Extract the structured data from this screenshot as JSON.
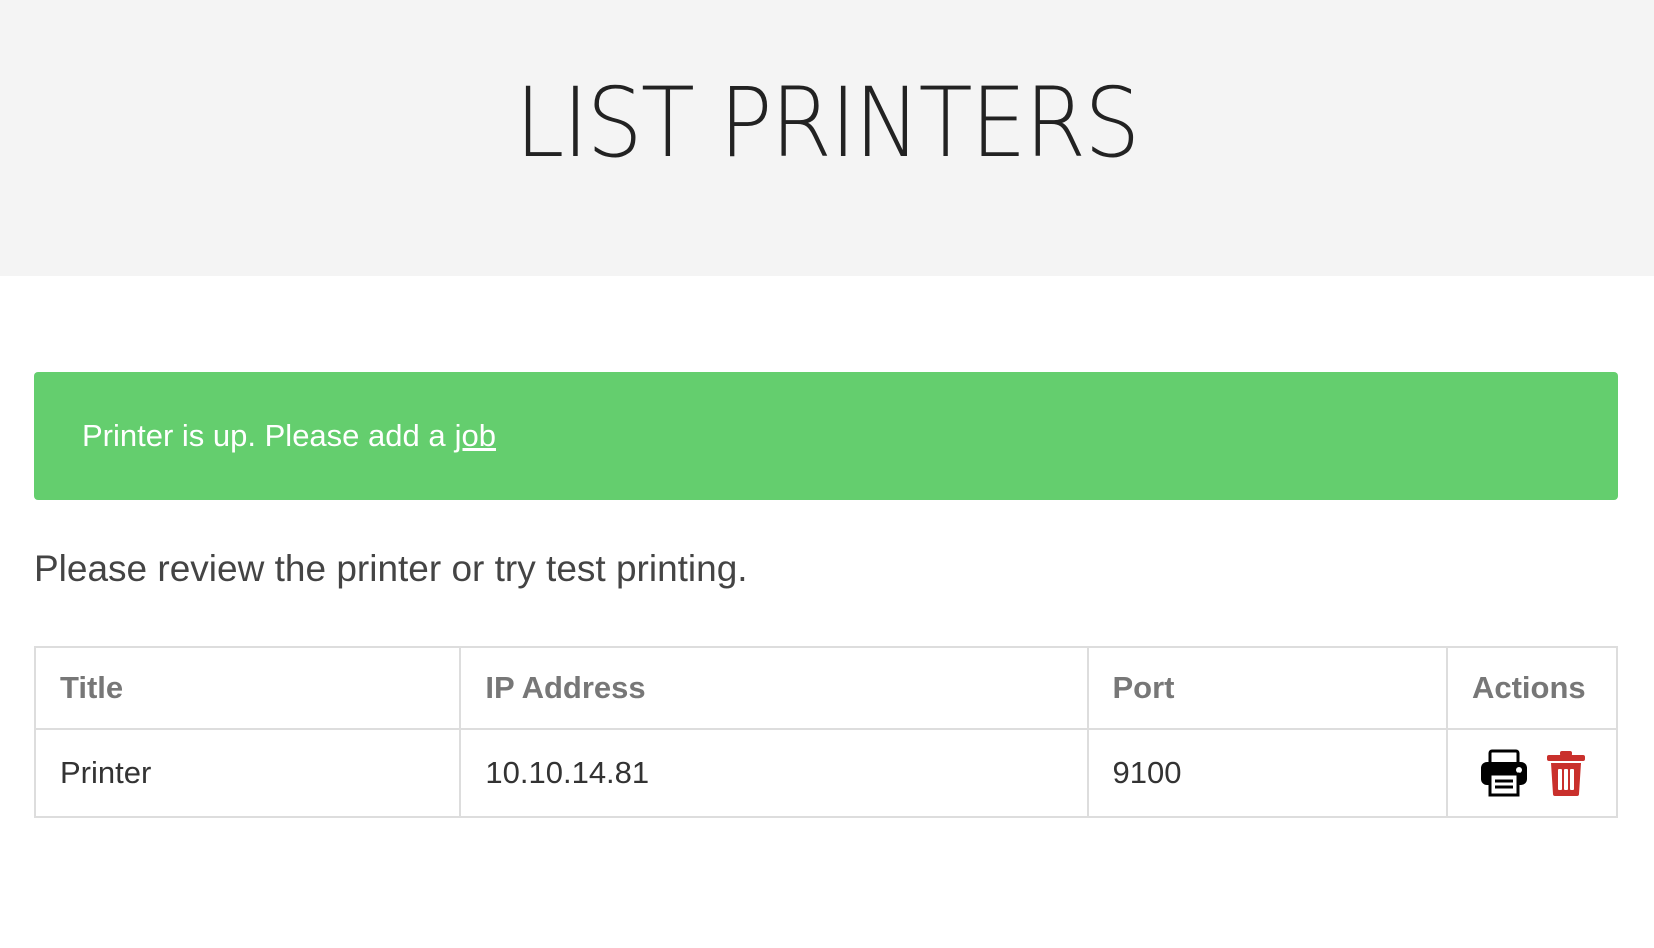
{
  "header": {
    "title": "LIST PRINTERS"
  },
  "alert": {
    "text": "Printer is up. Please add a",
    "link_label": "job",
    "color": "#64ce6e"
  },
  "lead": "Please review the printer or try test printing.",
  "table": {
    "columns": [
      "Title",
      "IP Address",
      "Port",
      "Actions"
    ],
    "rows": [
      {
        "title": "Printer",
        "ip": "10.10.14.81",
        "port": "9100",
        "actions": [
          "printer-icon",
          "trash-icon"
        ]
      }
    ]
  },
  "colors": {
    "header_bg": "#f4f4f4",
    "delete_red": "#c9302c"
  }
}
